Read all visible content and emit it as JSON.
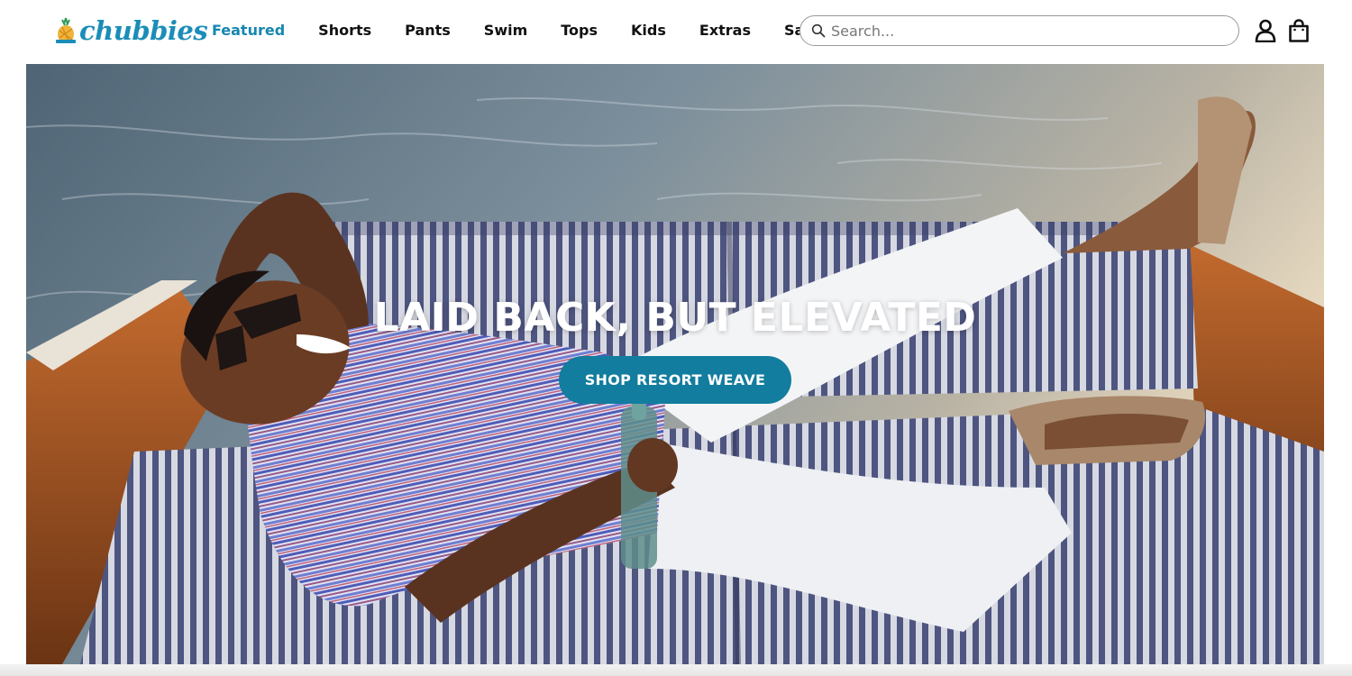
{
  "brand": {
    "name": "chubbies",
    "accent_color": "#1b8db8",
    "logo_icon": "pineapple-logo-icon"
  },
  "nav": {
    "items": [
      {
        "label": "Featured",
        "active": true
      },
      {
        "label": "Shorts",
        "active": false
      },
      {
        "label": "Pants",
        "active": false
      },
      {
        "label": "Swim",
        "active": false
      },
      {
        "label": "Tops",
        "active": false
      },
      {
        "label": "Kids",
        "active": false
      },
      {
        "label": "Extras",
        "active": false
      },
      {
        "label": "Sale",
        "active": false
      }
    ]
  },
  "search": {
    "placeholder": "Search...",
    "value": "",
    "icon": "search-icon"
  },
  "header_icons": {
    "account": "user-icon",
    "cart": "shopping-bag-icon"
  },
  "hero": {
    "title": "LAID BACK, BUT ELEVATED",
    "cta_label": "SHOP RESORT WEAVE",
    "cta_color": "#127d9e",
    "image": "man-relaxing-on-boat-photo"
  }
}
